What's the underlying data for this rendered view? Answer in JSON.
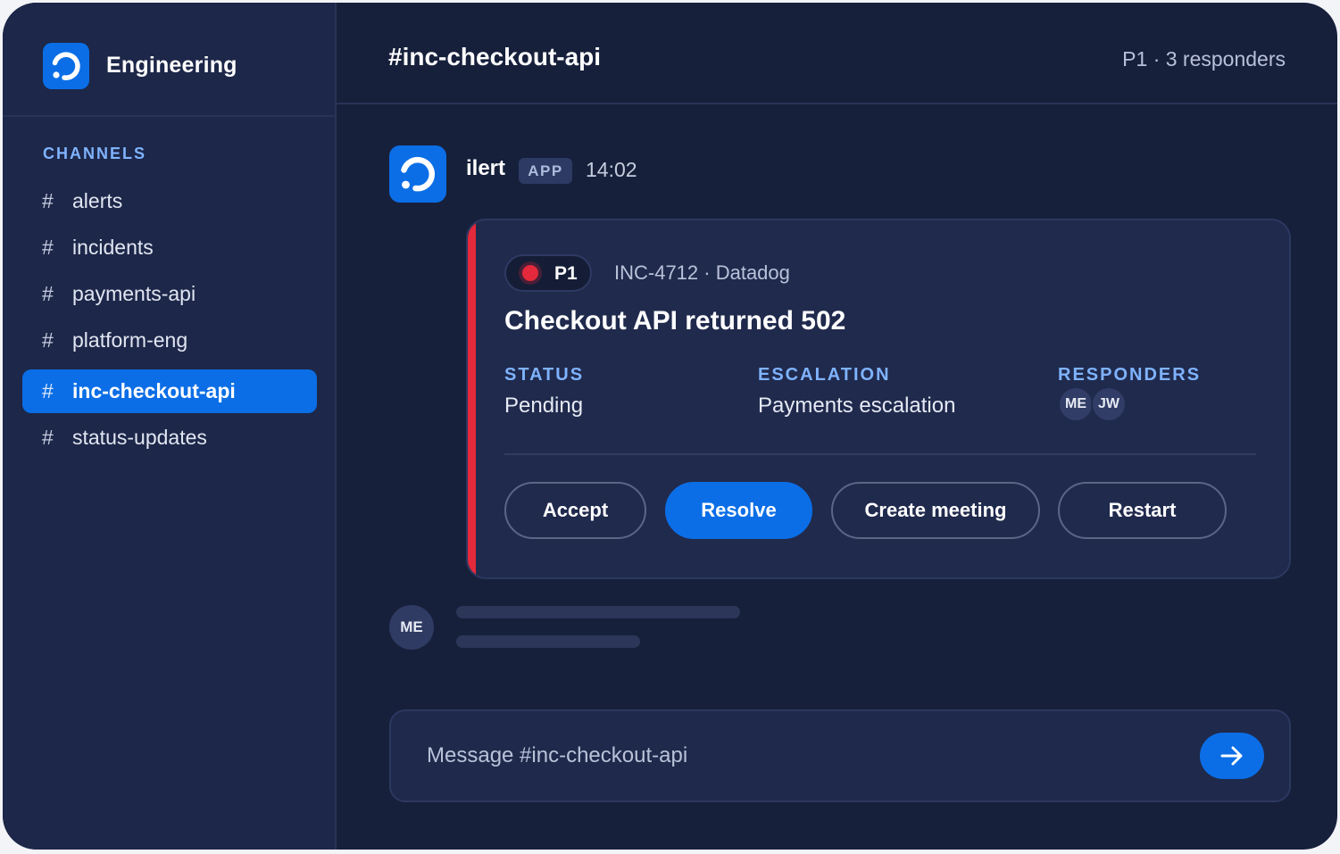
{
  "workspace": {
    "name": "Engineering",
    "logo_icon": "ilert-logo-icon",
    "accent": "#0b6ee6"
  },
  "sidebar": {
    "section_label": "CHANNELS",
    "channels": [
      {
        "hash": "#",
        "name": "alerts",
        "active": false
      },
      {
        "hash": "#",
        "name": "incidents",
        "active": false
      },
      {
        "hash": "#",
        "name": "payments-api",
        "active": false
      },
      {
        "hash": "#",
        "name": "platform-eng",
        "active": false
      },
      {
        "hash": "#",
        "name": "inc-checkout-api",
        "active": true
      },
      {
        "hash": "#",
        "name": "status-updates",
        "active": false
      }
    ]
  },
  "header": {
    "title": "#inc-checkout-api",
    "meta": "P1 · 3 responders"
  },
  "message": {
    "sender": "ilert",
    "badge": "APP",
    "time": "14:02",
    "avatar_icon": "ilert-logo-icon"
  },
  "incident": {
    "priority": "P1",
    "priority_color": "#e3293b",
    "reference": "INC-4712 · Datadog",
    "title": "Checkout API returned 502",
    "fields": {
      "status_label": "STATUS",
      "status_value": "Pending",
      "escalation_label": "ESCALATION",
      "escalation_value": "Payments escalation",
      "responders_label": "RESPONDERS",
      "responders": [
        "ME",
        "JW"
      ]
    },
    "actions": {
      "accept": "Accept",
      "resolve": "Resolve",
      "create_meeting": "Create meeting",
      "restart": "Restart"
    }
  },
  "typing": {
    "avatar": "ME"
  },
  "composer": {
    "placeholder": "Message #inc-checkout-api",
    "send_icon": "arrow-right-icon"
  }
}
